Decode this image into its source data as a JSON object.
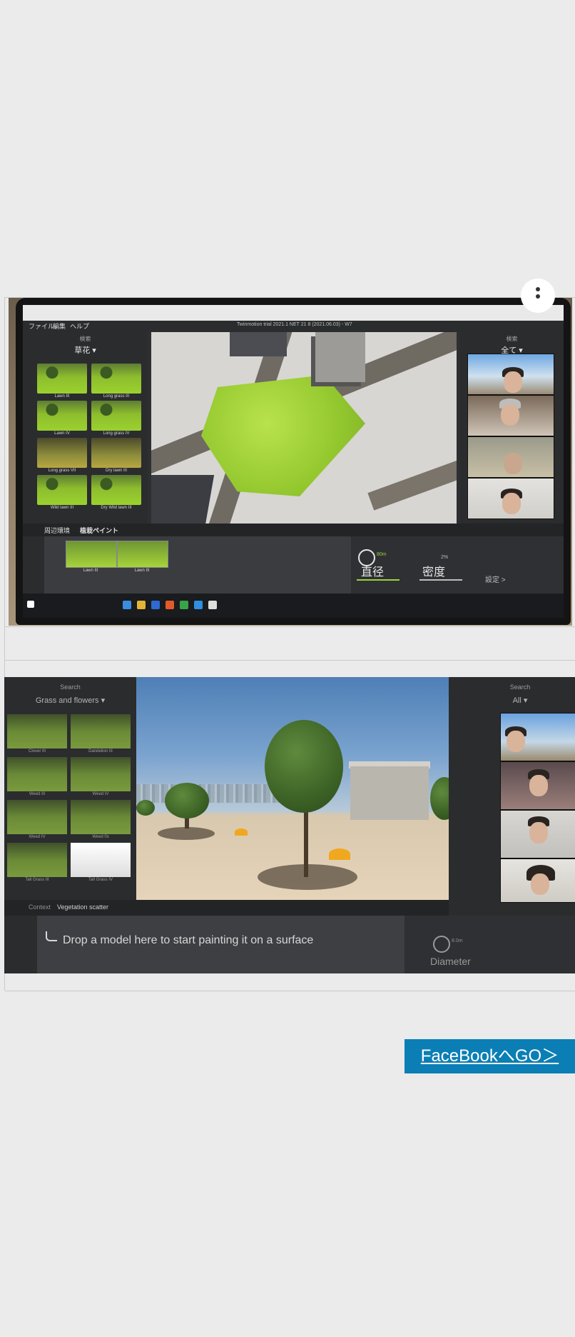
{
  "app_screen": {
    "menu": [
      "ファイル",
      "編集",
      "ヘルプ"
    ],
    "window_title": "Twinmotion trial 2021.1 NET 21 8 (2021.06.03) - W7",
    "left_panel": {
      "header": "検索",
      "dropdown": "草花 ▾",
      "thumbnails": [
        "Lawn III",
        "Long grass III",
        "Lawn IV",
        "Long grass IV",
        "Long grass VII",
        "Dry lawn III",
        "Wild lawn III",
        "Dry Wild lawn III"
      ]
    },
    "right_panel": {
      "header": "検索",
      "dropdown": "全て ▾"
    },
    "breadcrumb": [
      "周辺環境",
      "植栽ペイント"
    ],
    "bottom": {
      "thumbnails": [
        "Lawn III",
        "Lawn III"
      ],
      "diameter_label": "直径",
      "diameter_value": "80m",
      "density_label": "密度",
      "density_value": "2%",
      "settings_link": "設定 >"
    }
  },
  "scene_screen": {
    "left_panel": {
      "header": "Search",
      "dropdown": "Grass and flowers ▾",
      "thumbnails": [
        "Clover III",
        "Dandelion III",
        "Weed III",
        "Weed IV",
        "Weed IV",
        "Weed 0s",
        "Tall Grass III",
        "Tall Grass IV"
      ]
    },
    "right_panel": {
      "header": "Search",
      "dropdown": "All ▾"
    },
    "breadcrumb": [
      "Context",
      "Vegetation scatter"
    ],
    "drop_hint": "Drop a model here to start painting it on a surface",
    "diameter_label": "Diameter",
    "diameter_value": "8.0m"
  },
  "facebook_link": "FaceBookへGO＞",
  "colors": {
    "link_bg": "#0b7fb5",
    "page_bg": "#ebebeb",
    "ui_accent": "#9ad23f"
  }
}
